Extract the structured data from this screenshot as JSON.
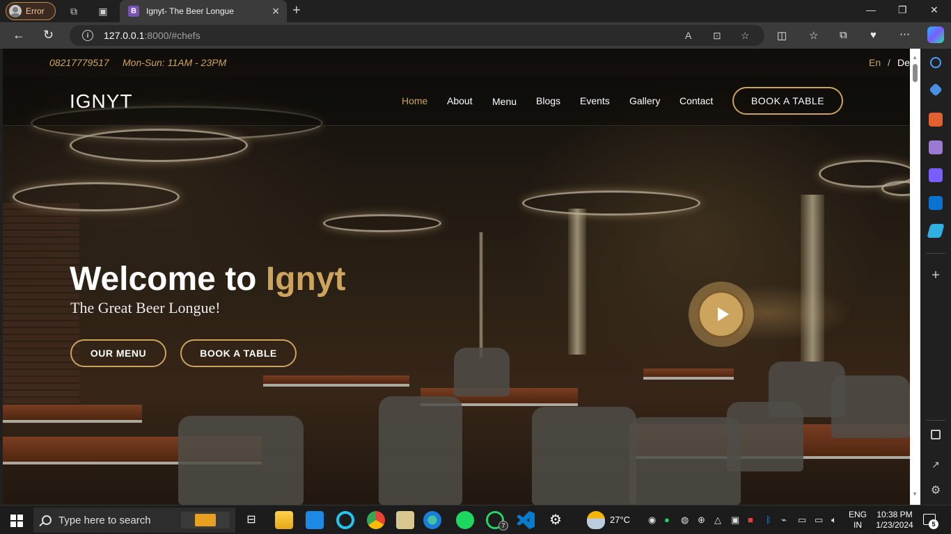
{
  "browser": {
    "profile_label": "Error",
    "tab_title": "Ignyt- The Beer Longue",
    "tab_favicon_letter": "B",
    "url_host": "127.0.0.1",
    "url_path": ":8000/#chefs"
  },
  "site": {
    "phone": "08217779517",
    "hours": "Mon-Sun: 11AM - 23PM",
    "lang_en": "En",
    "lang_sep": "/",
    "lang_de": "De",
    "logo": "IGNYT",
    "nav": [
      "Home",
      "About",
      "Menu",
      "Blogs",
      "Events",
      "Gallery",
      "Contact"
    ],
    "nav_active": "Home",
    "book_table": "BOOK A TABLE",
    "hero": {
      "title_prefix": "Welcome to ",
      "title_accent": "Ignyt",
      "subtitle": "The Great Beer Longue!",
      "btn_menu": "OUR MENU",
      "btn_book": "BOOK A TABLE"
    },
    "accent_color": "#cda45e"
  },
  "taskbar": {
    "search_placeholder": "Type here to search",
    "temperature": "27°C",
    "lang_line1": "ENG",
    "lang_line2": "IN",
    "time": "10:38 PM",
    "date": "1/23/2024",
    "whatsapp_badge": "7",
    "notification_count": "5"
  }
}
